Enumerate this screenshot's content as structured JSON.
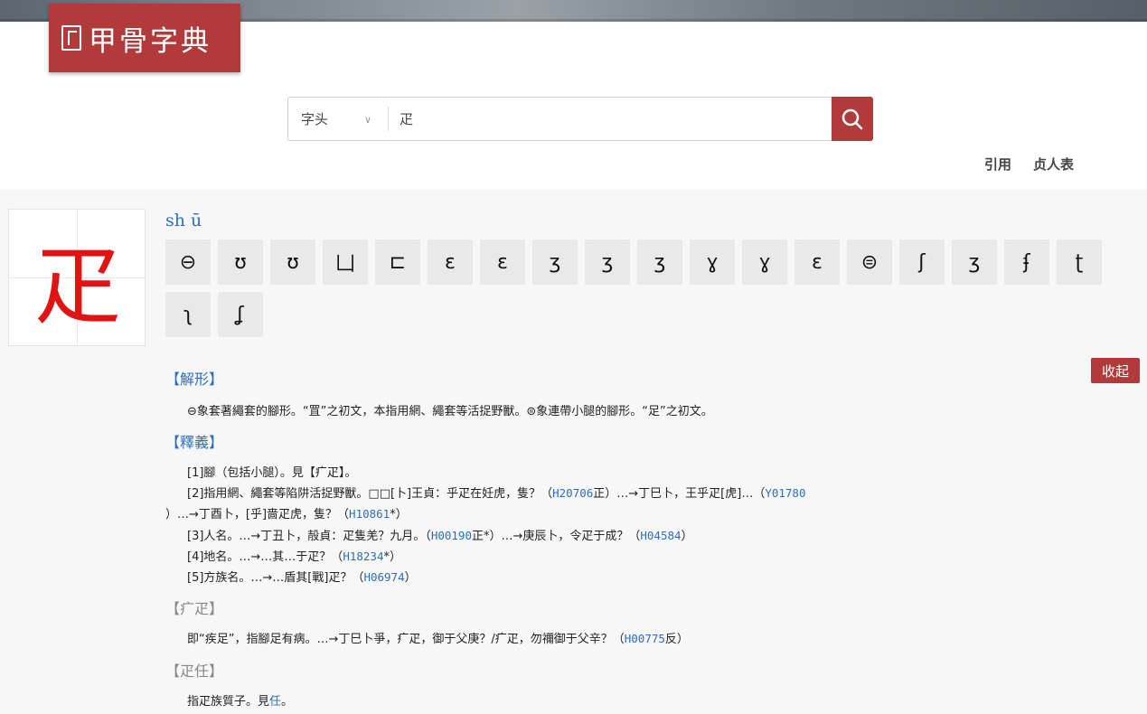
{
  "header": {
    "logo_text": "甲骨字典",
    "search": {
      "type_label": "字头",
      "query": "疋"
    },
    "links": [
      "引用",
      "贞人表"
    ]
  },
  "entry": {
    "character": "疋",
    "pinyin": "sh ū",
    "glyphs": [
      "⊖",
      "ʊ",
      "ʊ",
      "凵",
      "⊏",
      "ɛ",
      "ɛ",
      "ʒ",
      "ʒ",
      "ʒ",
      "ɣ",
      "ɣ",
      "ɛ",
      "⊜",
      "ʃ",
      "ʒ",
      "ʄ",
      "ʈ",
      "ʅ",
      "ʆ"
    ],
    "collapse_label": "收起",
    "sections": {
      "jiexing": {
        "title": "【解形】",
        "text": "⊖象套著繩套的腳形。“罝”之初文，本指用網、繩套等活捉野獸。⊜象連帶小腿的腳形。“足”之初文。"
      },
      "shiyi": {
        "title": "【釋義】",
        "items": [
          {
            "text": "[1]腳（包括小腿）。見【疒疋】。",
            "ref": ""
          },
          {
            "text_a": "[2]指用網、繩套等陷阱活捉野獸。□□[卜]王貞：乎疋在妊虎，隻？（",
            "ref_a": "H20706",
            "text_b": "正）…→丁巳卜，王乎疋[虎]…（",
            "ref_b": "Y01780"
          },
          {
            "text_a": "）…→丁酉卜，[乎]啬疋虎，隻？（",
            "ref_a": "H10861",
            "text_b": "*）"
          },
          {
            "text_a": "[3]人名。…→丁丑卜，㱿貞：疋隻羌？九月。（",
            "ref_a": "H00190",
            "text_b": "正*）…→庚辰卜，令疋于成？（",
            "ref_b": "H04584",
            "text_c": "）"
          },
          {
            "text_a": "[4]地名。…→…其…于疋？（",
            "ref_a": "H18234",
            "text_b": "*）"
          },
          {
            "text_a": "[5]方族名。…→…盾其[戰]疋？（",
            "ref_a": "H06974",
            "text_b": "）"
          }
        ]
      },
      "nizheng": {
        "title": "【疒疋】",
        "text_a": "即“疾足”，指腳足有病。…→丁巳卜爭，疒疋，御于父庚？/疒疋，勿禰御于父辛？（",
        "ref_a": "H00775",
        "text_b": "反）"
      },
      "zhengren": {
        "title": "【疋任】",
        "text_a": "指疋族質子。見",
        "link": "任",
        "text_b": "。"
      }
    }
  }
}
